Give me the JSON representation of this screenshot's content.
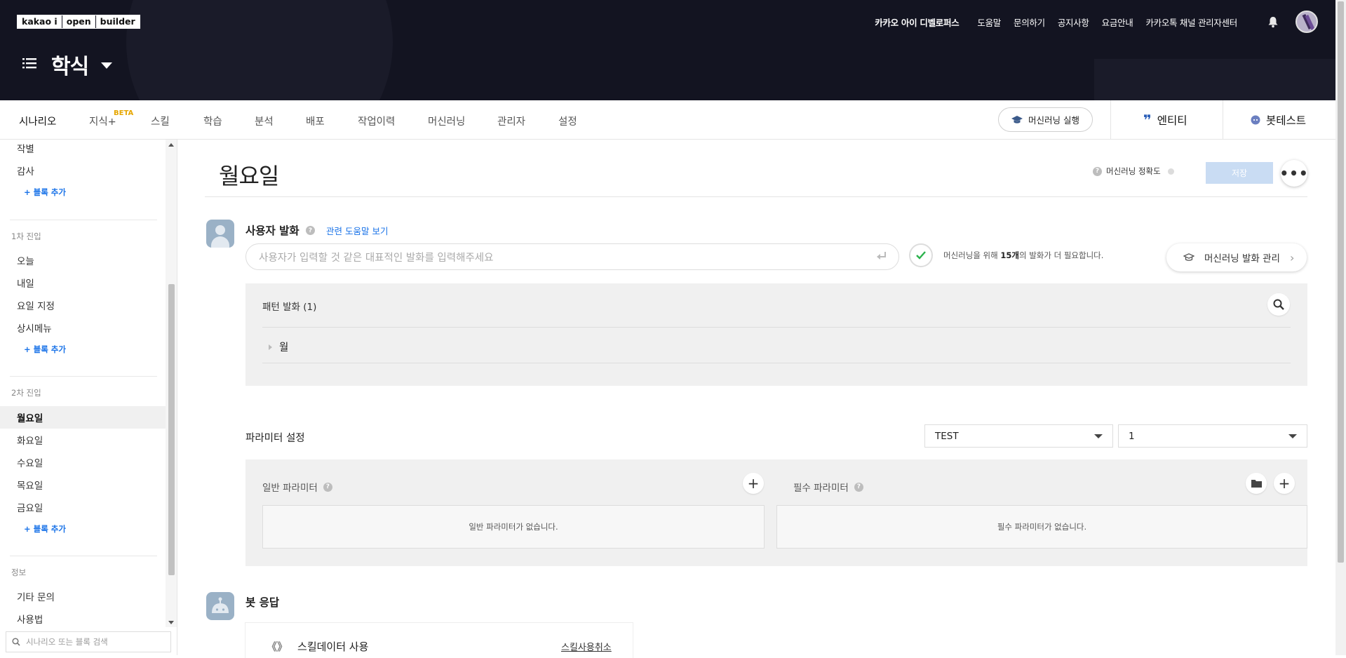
{
  "header": {
    "logo": [
      "kakao i",
      "open",
      "builder"
    ],
    "nav": [
      "카카오 아이 디벨로퍼스",
      "도움말",
      "문의하기",
      "공지사항",
      "요금안내",
      "카카오톡 채널 관리자센터"
    ],
    "bot_name": "학식"
  },
  "tabs": {
    "items": [
      "시나리오",
      "지식+",
      "스킬",
      "학습",
      "분석",
      "배포",
      "작업이력",
      "머신러닝",
      "관리자",
      "설정"
    ],
    "beta": "BETA",
    "ml_run": "머신러닝 실행",
    "entity": "엔티티",
    "bot_test": "봇테스트"
  },
  "sidebar": {
    "top_items": [
      "작별",
      "감사"
    ],
    "add_block": "+ 블록 추가",
    "group1": {
      "title": "1차 진입",
      "items": [
        "오늘",
        "내일",
        "요일 지정",
        "상시메뉴"
      ]
    },
    "group2": {
      "title": "2차 진입",
      "items": [
        "월요일",
        "화요일",
        "수요일",
        "목요일",
        "금요일"
      ]
    },
    "group3": {
      "title": "정보",
      "items": [
        "기타 문의",
        "사용법"
      ]
    },
    "search_placeholder": "시나리오 또는 블록 검색"
  },
  "main": {
    "title": "월요일",
    "ml_accuracy": "머신러닝 정확도",
    "save": "저장",
    "user_utterance": "사용자 발화",
    "help_link": "관련 도움말 보기",
    "utterance_placeholder": "사용자가 입력할 것 같은 대표적인 발화를 입력해주세요",
    "ml_hint_pre": "머신러닝을 위해 ",
    "ml_hint_count": "15개",
    "ml_hint_post": "의 발화가 더 필요합니다.",
    "ml_manage": "머신러닝 발화 관리",
    "pattern_title": "패턴 발화 (1)",
    "pattern_items": [
      "월"
    ],
    "param_title": "파라미터 설정",
    "select1": "TEST",
    "select2": "1",
    "general_param": "일반 파라미터",
    "required_param": "필수 파라미터",
    "general_empty": "일반 파라미터가 없습니다.",
    "required_empty": "필수 파라미터가 없습니다.",
    "bot_response": "봇 응답",
    "skill_data": "스킬데이터 사용",
    "skill_cancel": "스킬사용취소"
  }
}
